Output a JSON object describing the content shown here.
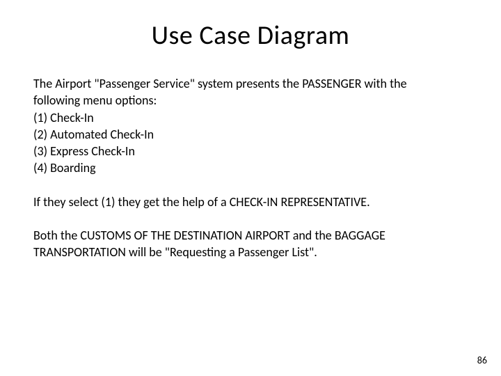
{
  "title": "Use Case Diagram",
  "intro_line1": "The Airport \"Passenger Service\" system presents the PASSENGER with the",
  "intro_line2": "following menu options:",
  "options": {
    "o1": "(1) Check-In",
    "o2": "(2) Automated Check-In",
    "o3": "(3) Express Check-In",
    "o4": "(4) Boarding"
  },
  "para2": "If they select (1) they get the help of a CHECK-IN REPRESENTATIVE.",
  "para3_line1": "Both the CUSTOMS OF THE DESTINATION AIRPORT and the BAGGAGE",
  "para3_line2": "TRANSPORTATION will be \"Requesting a Passenger List\".",
  "page_number": "86"
}
